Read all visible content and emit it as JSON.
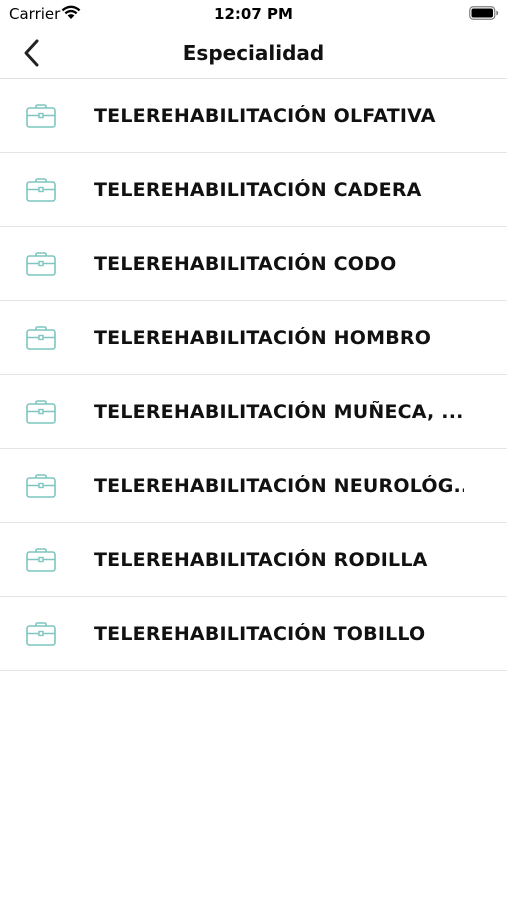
{
  "status_bar": {
    "carrier": "Carrier",
    "time": "12:07 PM",
    "wifi_icon": "wifi-icon",
    "battery_icon": "battery-icon"
  },
  "nav": {
    "title": "Especialidad",
    "back_icon": "chevron-left-icon"
  },
  "colors": {
    "accent": "#7fc5c0",
    "text": "#111111",
    "divider": "#e4e4e4"
  },
  "specialties": {
    "icon": "briefcase-icon",
    "items": [
      {
        "label": "TELEREHABILITACIÓN OLFATIVA"
      },
      {
        "label": "TELEREHABILITACIÓN CADERA"
      },
      {
        "label": "TELEREHABILITACIÓN CODO"
      },
      {
        "label": "TELEREHABILITACIÓN HOMBRO"
      },
      {
        "label": "TELEREHABILITACIÓN MUÑECA, ..."
      },
      {
        "label": "TELEREHABILITACIÓN NEUROLÓG..."
      },
      {
        "label": "TELEREHABILITACIÓN RODILLA"
      },
      {
        "label": "TELEREHABILITACIÓN TOBILLO"
      }
    ]
  }
}
